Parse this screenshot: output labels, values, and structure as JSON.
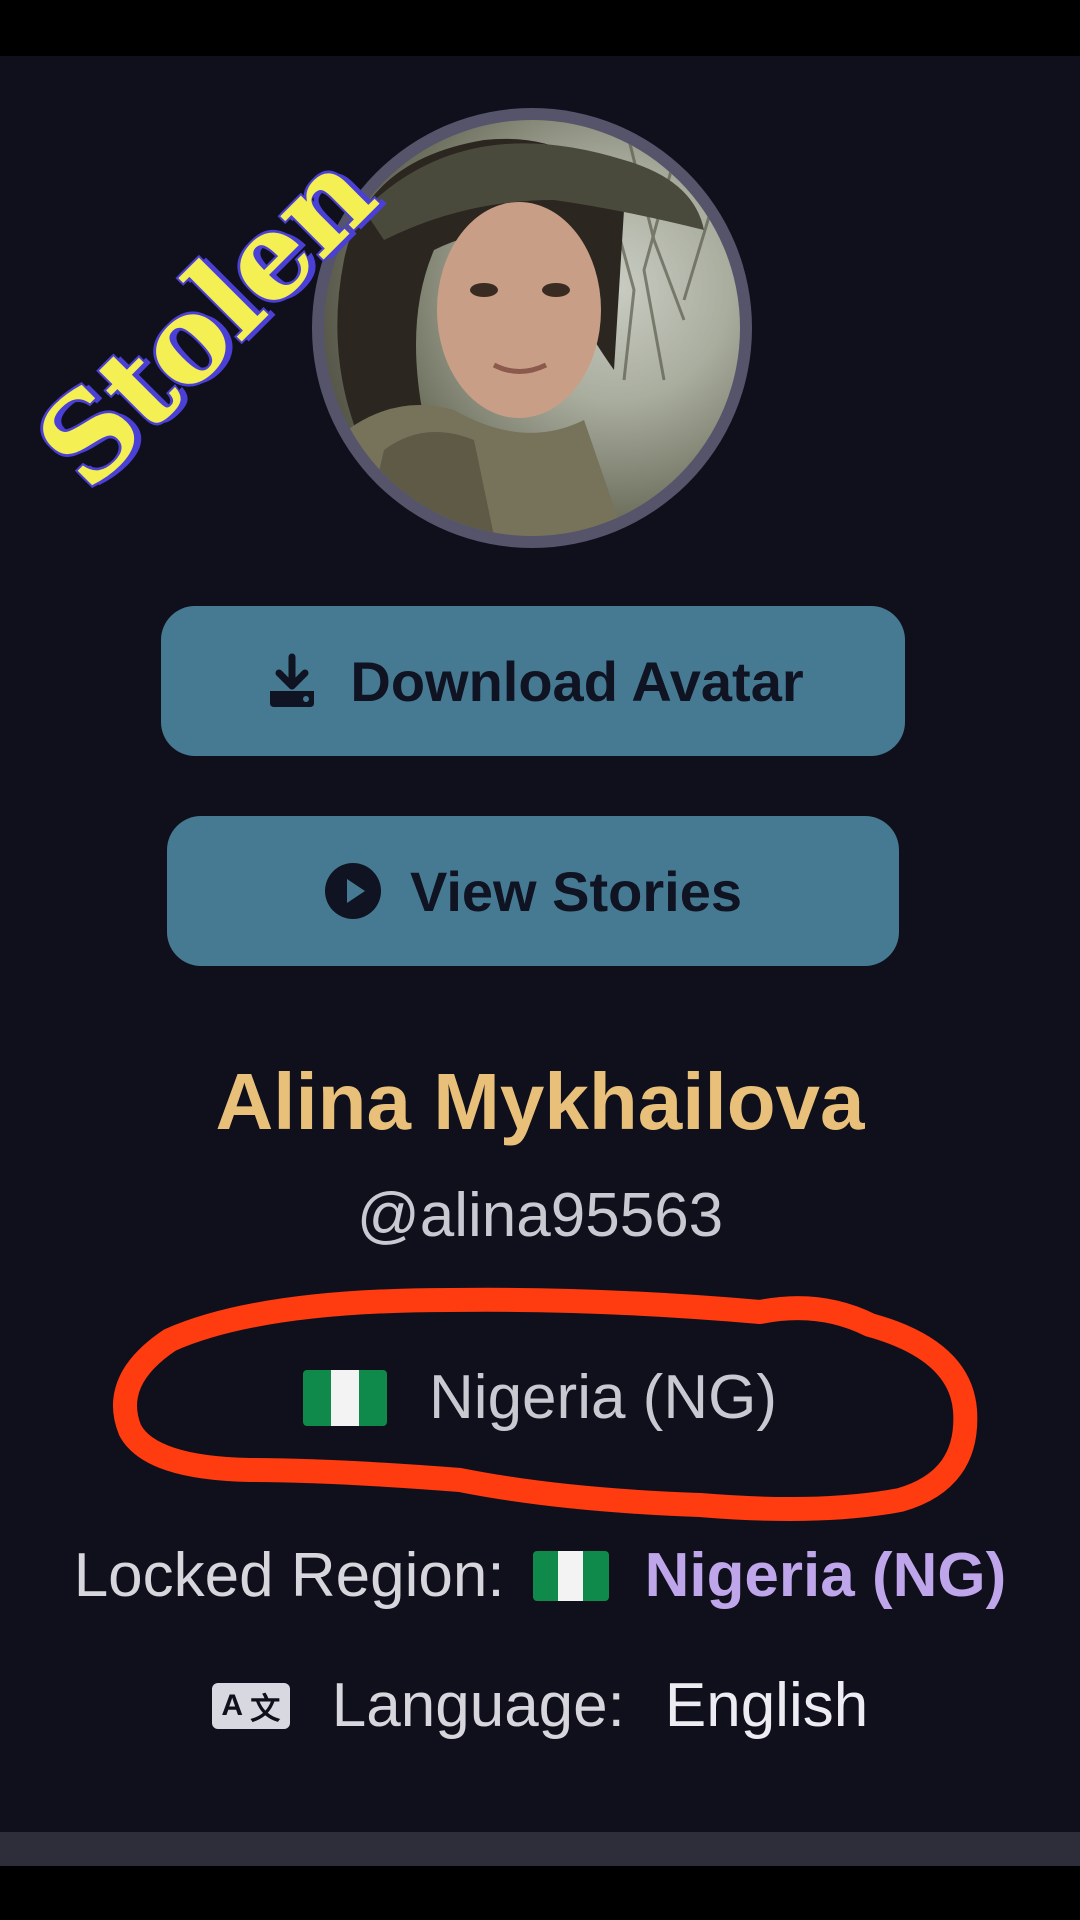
{
  "watermark": {
    "text": "Stolen"
  },
  "profile": {
    "name": "Alina Mykhailova",
    "handle": "@alina95563"
  },
  "actions": {
    "download_label": "Download Avatar",
    "stories_label": "View Stories"
  },
  "country": {
    "flag_icon": "nigeria-flag-icon",
    "label": "Nigeria (NG)"
  },
  "locked_region": {
    "label": "Locked Region:",
    "value": "Nigeria (NG)"
  },
  "language": {
    "icon": "translate-icon",
    "label": "Language:",
    "value": "English"
  },
  "colors": {
    "background": "#10101c",
    "button": "#467a93",
    "name": "#e9c07a",
    "region_value": "#bfa6ea",
    "highlight": "#ff3b10"
  }
}
